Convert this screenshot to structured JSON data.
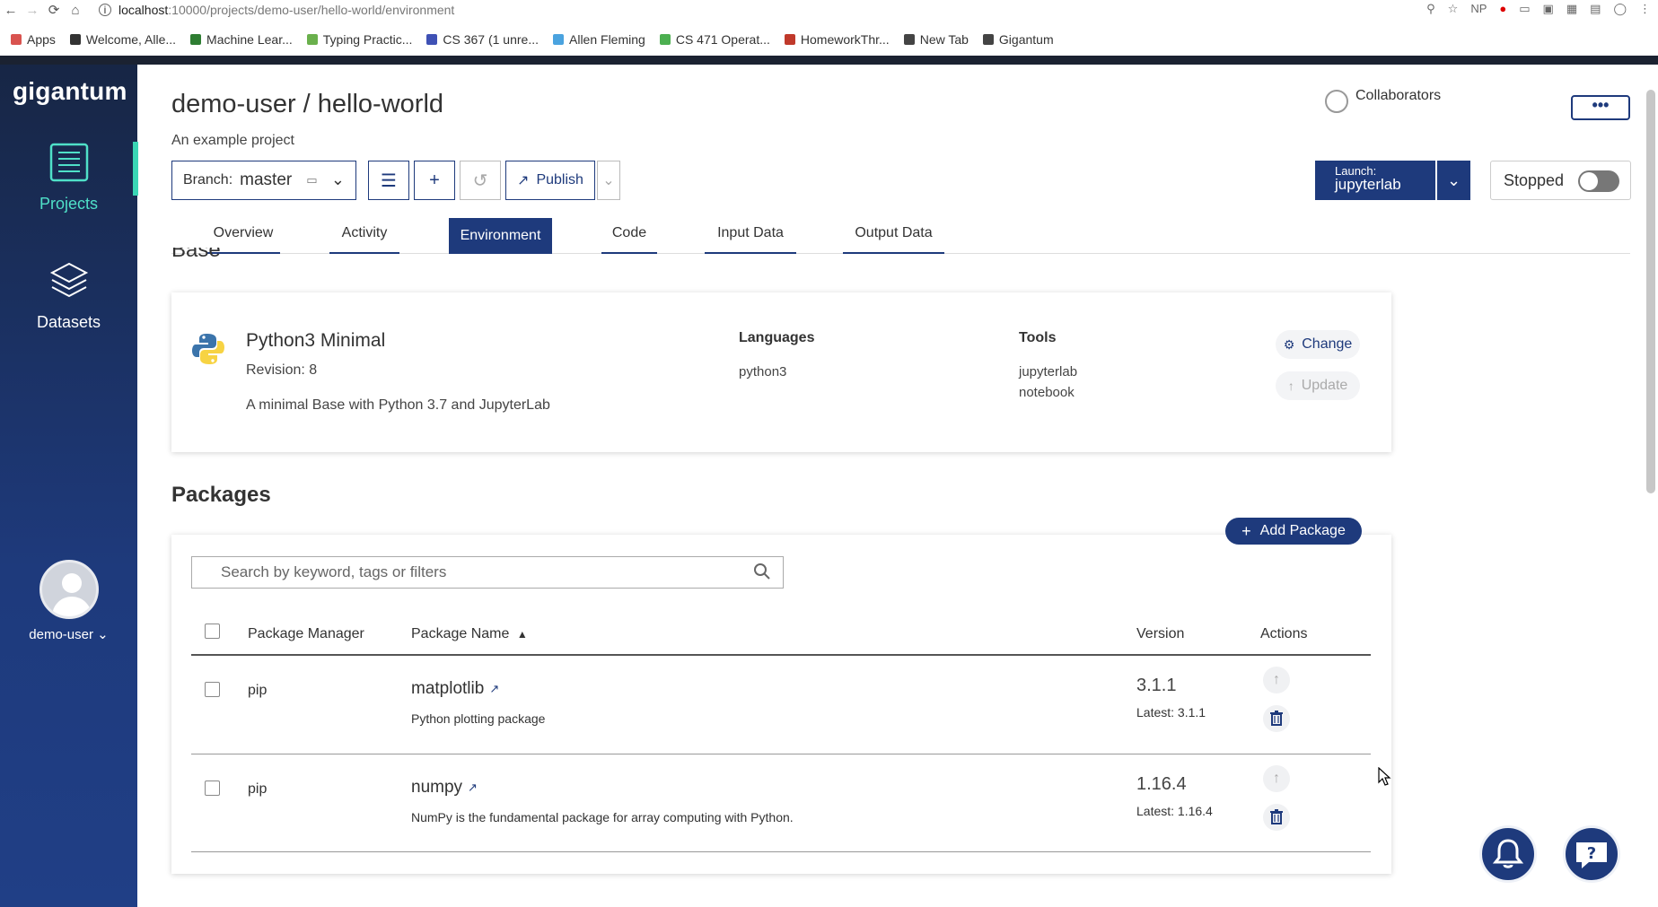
{
  "browser": {
    "url_host": "localhost",
    "url_path": ":10000/projects/demo-user/hello-world/environment",
    "bookmarks": [
      {
        "label": "Apps",
        "color": "#d9534f"
      },
      {
        "label": "Welcome, Alle...",
        "color": "#333333"
      },
      {
        "label": "Machine Lear...",
        "color": "#2e7d32"
      },
      {
        "label": "Typing Practic...",
        "color": "#6ab04c"
      },
      {
        "label": "CS 367 (1 unre...",
        "color": "#3f51b5"
      },
      {
        "label": "Allen Fleming",
        "color": "#4aa3df"
      },
      {
        "label": "CS 471 Operat...",
        "color": "#4caf50"
      },
      {
        "label": "HomeworkThr...",
        "color": "#c0392b"
      },
      {
        "label": "New Tab",
        "color": "#444444"
      },
      {
        "label": "Gigantum",
        "color": "#444444"
      }
    ],
    "ext_np": "NP"
  },
  "sidebar": {
    "logo": "gigantum",
    "items": [
      {
        "label": "Projects"
      },
      {
        "label": "Datasets"
      }
    ],
    "user": "demo-user"
  },
  "header": {
    "title": "demo-user / hello-world",
    "subtitle": "An example project",
    "collaborators": "Collaborators",
    "more": "•••"
  },
  "toolbar": {
    "branch_label": "Branch:",
    "branch_value": "master",
    "publish": "Publish",
    "launch_small": "Launch:",
    "launch_value": "jupyterlab",
    "status": "Stopped"
  },
  "tabs": [
    {
      "label": "Overview"
    },
    {
      "label": "Activity"
    },
    {
      "label": "Environment"
    },
    {
      "label": "Code"
    },
    {
      "label": "Input Data"
    },
    {
      "label": "Output Data"
    }
  ],
  "base": {
    "section_title": "Base",
    "name": "Python3 Minimal",
    "revision": "Revision: 8",
    "description": "A minimal Base with Python 3.7 and JupyterLab",
    "languages_label": "Languages",
    "languages": [
      "python3"
    ],
    "tools_label": "Tools",
    "tools": [
      "jupyterlab",
      "notebook"
    ],
    "change": "Change",
    "update": "Update"
  },
  "packages": {
    "title": "Packages",
    "add": "Add Package",
    "search_placeholder": "Search by keyword, tags or filters",
    "columns": {
      "manager": "Package Manager",
      "name": "Package Name",
      "version": "Version",
      "actions": "Actions"
    },
    "rows": [
      {
        "manager": "pip",
        "name": "matplotlib",
        "description": "Python plotting package",
        "version": "3.1.1",
        "latest": "Latest: 3.1.1"
      },
      {
        "manager": "pip",
        "name": "numpy",
        "description": "NumPy is the fundamental package for array computing with Python.",
        "version": "1.16.4",
        "latest": "Latest: 1.16.4"
      }
    ]
  },
  "colors": {
    "brand": "#1e3a7c",
    "accent": "#3ad6b5"
  }
}
